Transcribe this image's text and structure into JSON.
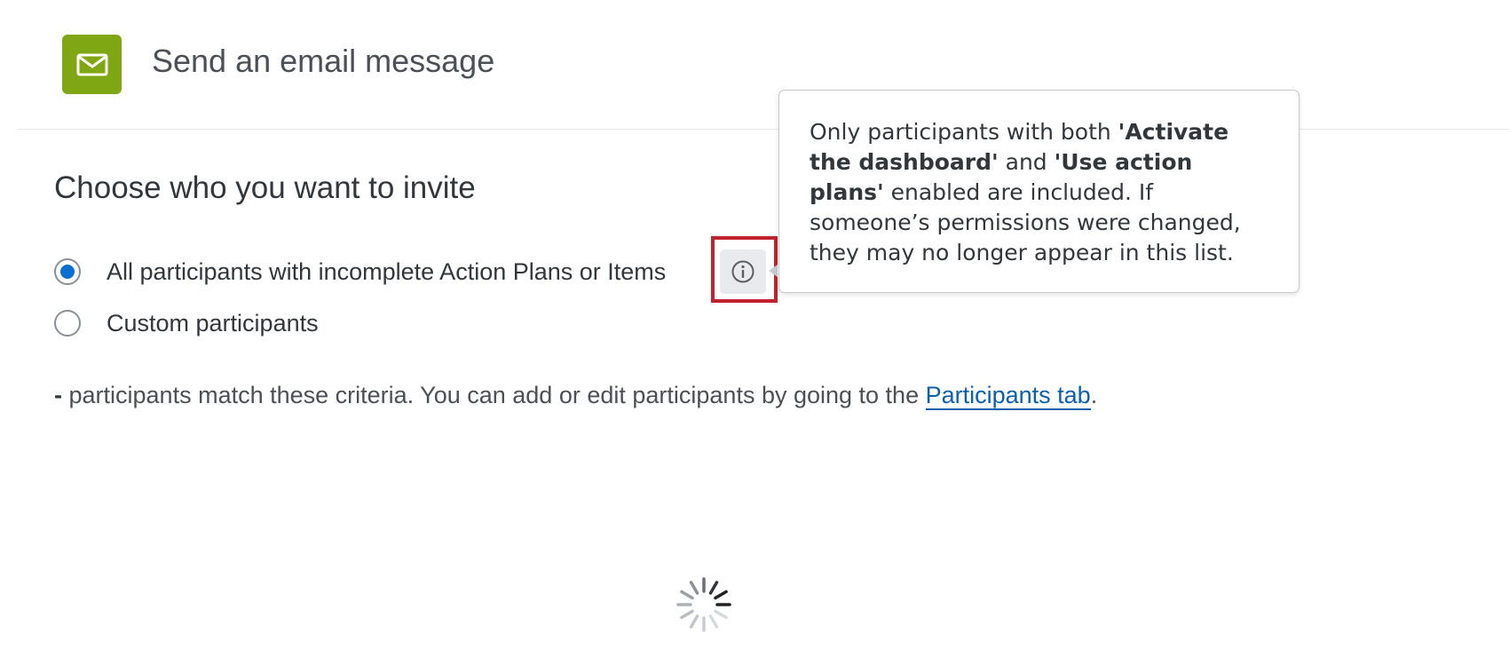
{
  "header": {
    "title": "Send an email message",
    "icon": "envelope-icon",
    "icon_color": "#7ea713"
  },
  "section": {
    "heading": "Choose who you want to invite"
  },
  "options": [
    {
      "label": "All participants with incomplete Action Plans or Items",
      "selected": true
    },
    {
      "label": "Custom participants",
      "selected": false
    }
  ],
  "info": {
    "icon": "info-icon"
  },
  "tooltip": {
    "t1": "Only participants with both ",
    "b1": "'Activate the dashboard'",
    "t2": " and ",
    "b2": "'Use action plans'",
    "t3": " enabled are included. If someone’s permissions were changed, they may no longer appear in this list."
  },
  "criteria": {
    "count": "-",
    "text": " participants match these criteria. You can add or edit participants by going to the ",
    "link": "Participants tab",
    "suffix": "."
  },
  "loading": {
    "icon": "loading-spinner-icon"
  }
}
